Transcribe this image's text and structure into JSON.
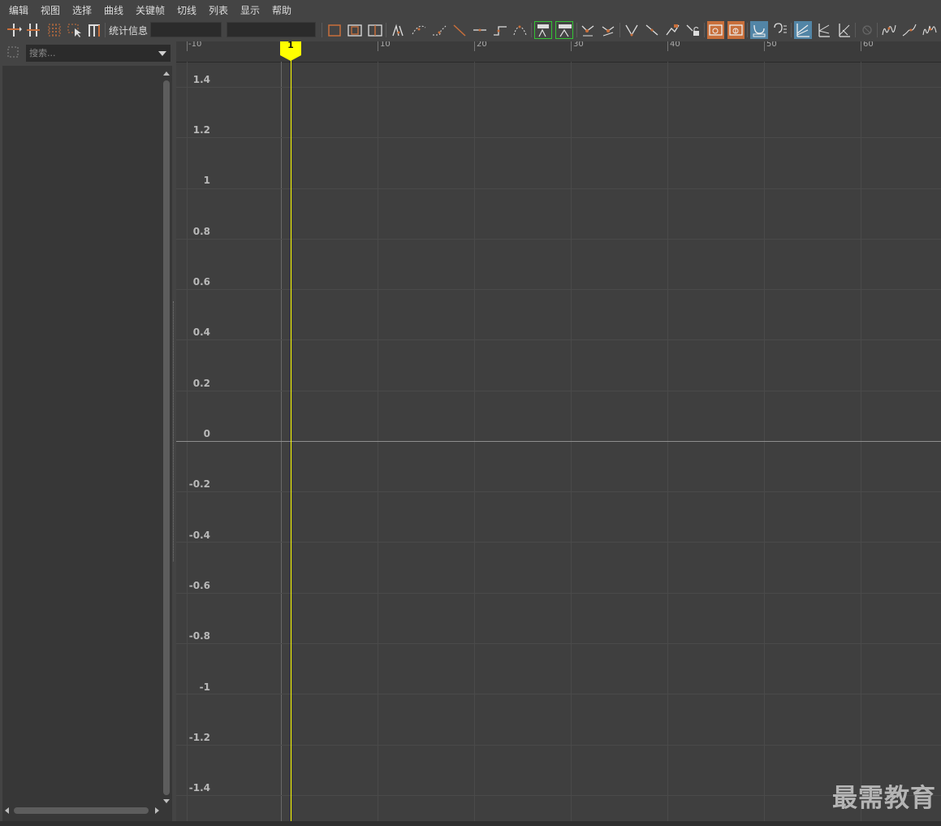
{
  "menu": [
    "编辑",
    "视图",
    "选择",
    "曲线",
    "关键帧",
    "切线",
    "列表",
    "显示",
    "帮助"
  ],
  "toolbar": {
    "stats_label": "统计信息",
    "stats_field_1": "",
    "stats_field_2": "",
    "colors": {
      "icon_orange": "#c86f3b",
      "toggle_blue": "#5285a6",
      "key_green": "#34c434"
    }
  },
  "outliner": {
    "search_placeholder": "搜索..."
  },
  "graph": {
    "frame_ticks": [
      "-10",
      "10",
      "20",
      "30",
      "40",
      "50",
      "60"
    ],
    "value_labels": [
      "1.4",
      "1.2",
      "1",
      "0.8",
      "0.6",
      "0.4",
      "0.2",
      "0",
      "-0.2",
      "-0.4",
      "-0.6",
      "-0.8",
      "-1",
      "-1.2",
      "-1.4"
    ],
    "current_frame": "1",
    "current_time_color": "#ffff00"
  },
  "watermark": "最需教育"
}
